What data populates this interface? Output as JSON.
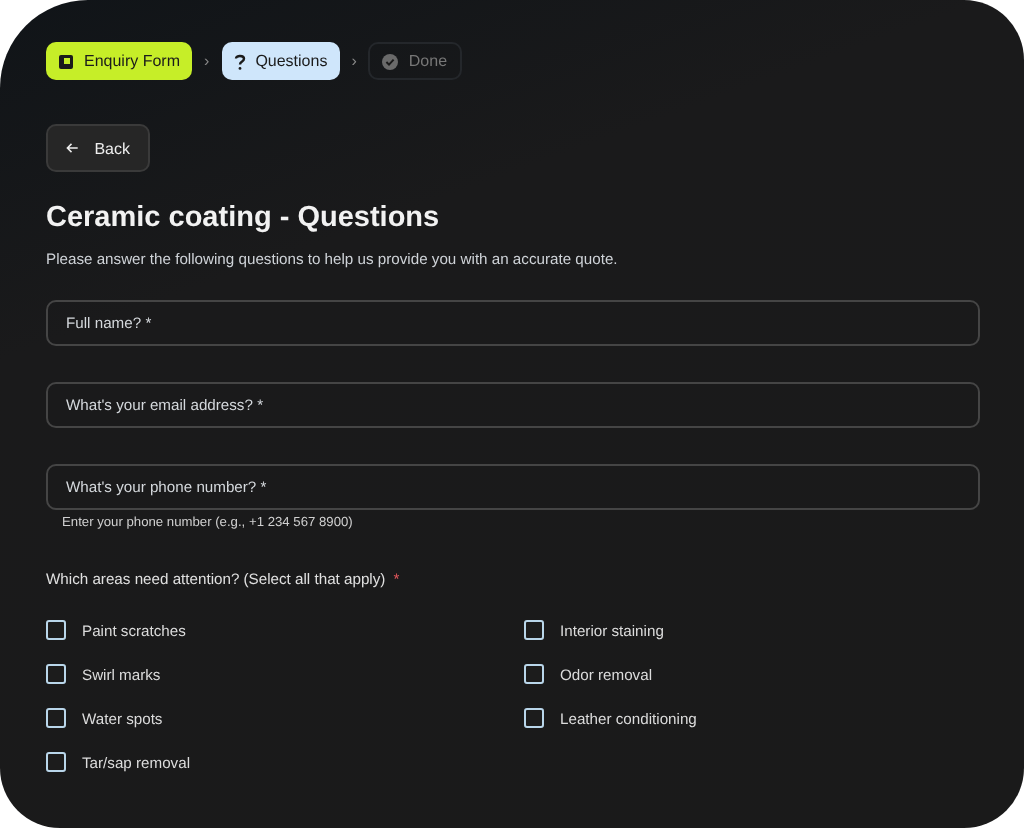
{
  "steps": [
    {
      "label": "Enquiry Form",
      "kind": "complete"
    },
    {
      "label": "Questions",
      "kind": "current"
    },
    {
      "label": "Done",
      "kind": "upcoming"
    }
  ],
  "separator": "›",
  "back_button": {
    "label": "Back"
  },
  "title": "Ceramic coating - Questions",
  "subtitle": "Please answer the following questions to help us provide you with an accurate quote.",
  "fields": [
    {
      "placeholder": "Full name?",
      "required_mark": "*"
    },
    {
      "placeholder": "What's your email address?",
      "required_mark": "*"
    },
    {
      "placeholder": "What's your phone number?",
      "required_mark": "*",
      "help": "Enter your phone number (e.g., +1 234 567 8900)"
    }
  ],
  "question": {
    "label": "Which areas need attention? (Select all that apply)",
    "required_mark": "*"
  },
  "options": [
    {
      "label": "Paint scratches",
      "checked": false
    },
    {
      "label": "Swirl marks",
      "checked": false
    },
    {
      "label": "Water spots",
      "checked": false
    },
    {
      "label": "Tar/sap removal",
      "checked": false
    },
    {
      "label": "Interior staining",
      "checked": false
    },
    {
      "label": "Odor removal",
      "checked": false
    },
    {
      "label": "Leather conditioning",
      "checked": false
    }
  ]
}
